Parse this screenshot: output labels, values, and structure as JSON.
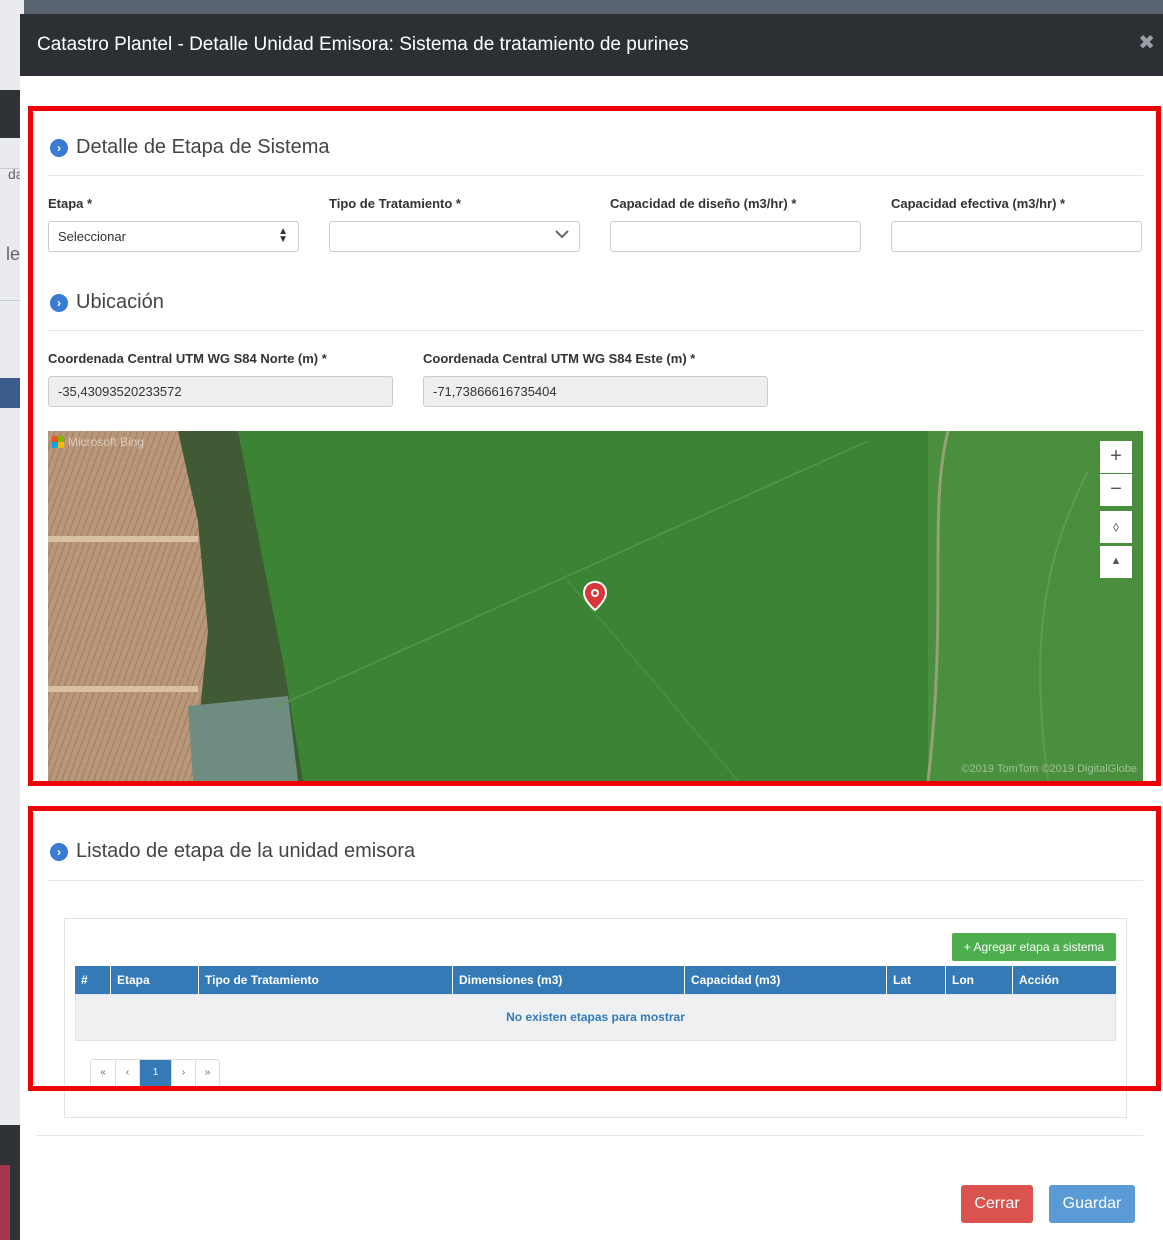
{
  "modal": {
    "title": "Catastro Plantel - Detalle Unidad Emisora: Sistema de tratamiento de purines",
    "close_glyph": "✖"
  },
  "background_page": {
    "fragment_1": "da",
    "fragment_2": "le"
  },
  "section_detalle": {
    "title": "Detalle de Etapa de Sistema",
    "etapa": {
      "label": "Etapa *",
      "value": "Seleccionar"
    },
    "tipo_tratamiento": {
      "label": "Tipo de Tratamiento *",
      "value": ""
    },
    "capacidad_diseno": {
      "label": "Capacidad de diseño (m3/hr) *",
      "value": ""
    },
    "capacidad_efectiva": {
      "label": "Capacidad efectiva (m3/hr) *",
      "value": ""
    }
  },
  "section_ubicacion": {
    "title": "Ubicación",
    "norte": {
      "label": "Coordenada Central UTM WG S84 Norte (m) *",
      "value": "-35,43093520233572"
    },
    "este": {
      "label": "Coordenada Central UTM WG S84 Este (m) *",
      "value": "-71,73866616735404"
    }
  },
  "map": {
    "provider_text": "Microsoft Bing",
    "copyright": "©2019 TomTom ©2019 DigitalGlobe",
    "zoom_in": "+",
    "zoom_out": "−",
    "compass": "⬨",
    "view_toggle": "▲"
  },
  "section_listado": {
    "title": "Listado de etapa de la unidad emisora",
    "add_button": "+ Agregar etapa a sistema",
    "columns": [
      "#",
      "Etapa",
      "Tipo de Tratamiento",
      "Dimensiones (m3)",
      "Capacidad (m3)",
      "Lat",
      "Lon",
      "Acción"
    ],
    "empty_message": "No existen etapas para mostrar",
    "pagination": {
      "first": "«",
      "prev": "‹",
      "current": "1",
      "next": "›",
      "last": "»"
    }
  },
  "footer": {
    "cerrar": "Cerrar",
    "guardar": "Guardar"
  },
  "colors": {
    "header_bg": "#2c3035",
    "accent_blue": "#337ab7",
    "success_green": "#4cae4c",
    "danger_red": "#d9534f",
    "highlight_red": "#f00000"
  }
}
